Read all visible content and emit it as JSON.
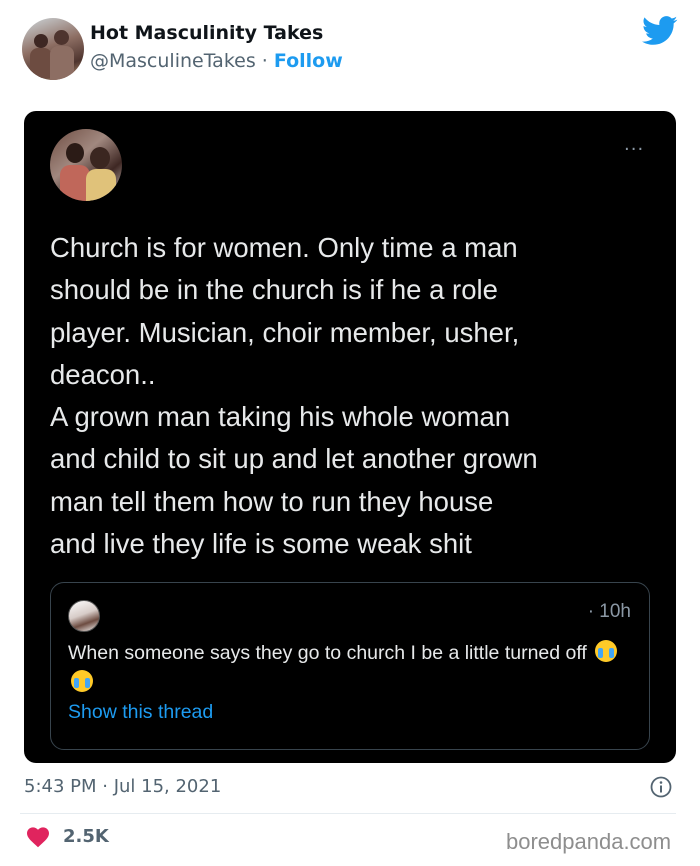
{
  "header": {
    "display_name": "Hot Masculinity Takes",
    "handle": "@MasculineTakes",
    "separator": " · ",
    "follow_label": "Follow",
    "brand_icon": "twitter-bird-icon",
    "brand_color": "#1d9bf0"
  },
  "embedded_tweet": {
    "more_label": "···",
    "text": "Church is for women. Only time a man\nshould be in the church is if he a role\nplayer. Musician, choir member, usher,\ndeacon..\nA grown man taking his whole woman\nand child to sit up and let another grown\nman tell them how to run they house\nand live they life is some weak shit",
    "quote": {
      "time": "· 10h",
      "text": "When someone says they go to church I be a little turned off",
      "emoji": "loudly-crying-face-icon",
      "show_thread_label": "Show this thread"
    }
  },
  "footer": {
    "timestamp": "5:43 PM · Jul 15, 2021",
    "likes": "2.5K",
    "watermark": "boredpanda.com",
    "like_color": "#e0245e"
  }
}
